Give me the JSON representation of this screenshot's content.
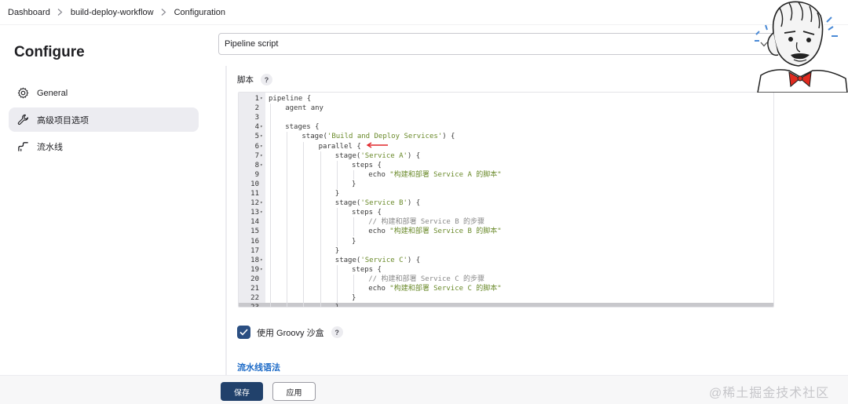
{
  "breadcrumb": {
    "items": [
      "Dashboard",
      "build-deploy-workflow",
      "Configuration"
    ]
  },
  "sidebar": {
    "title": "Configure",
    "items": [
      {
        "label": "General",
        "icon": "gear-icon"
      },
      {
        "label": "高级项目选项",
        "icon": "wrench-icon",
        "active": true
      },
      {
        "label": "流水线",
        "icon": "pipeline-icon"
      }
    ]
  },
  "definition": {
    "selected": "Pipeline script"
  },
  "script": {
    "label": "脚本",
    "help": "?",
    "lines": [
      {
        "n": "1",
        "fold": true,
        "indent": 0,
        "parts": [
          {
            "t": "pipeline {",
            "c": "kw"
          }
        ]
      },
      {
        "n": "2",
        "fold": false,
        "indent": 1,
        "parts": [
          {
            "t": "agent any",
            "c": "kw"
          }
        ]
      },
      {
        "n": "3",
        "fold": false,
        "indent": 0,
        "parts": []
      },
      {
        "n": "4",
        "fold": true,
        "indent": 1,
        "parts": [
          {
            "t": "stages {",
            "c": "kw"
          }
        ]
      },
      {
        "n": "5",
        "fold": true,
        "indent": 2,
        "parts": [
          {
            "t": "stage(",
            "c": "kw"
          },
          {
            "t": "'Build and Deploy Services'",
            "c": "str"
          },
          {
            "t": ") {",
            "c": "kw"
          }
        ]
      },
      {
        "n": "6",
        "fold": true,
        "indent": 3,
        "parts": [
          {
            "t": "parallel {",
            "c": "kw"
          }
        ]
      },
      {
        "n": "7",
        "fold": true,
        "indent": 4,
        "parts": [
          {
            "t": "stage(",
            "c": "kw"
          },
          {
            "t": "'Service A'",
            "c": "str"
          },
          {
            "t": ") {",
            "c": "kw"
          }
        ]
      },
      {
        "n": "8",
        "fold": true,
        "indent": 5,
        "parts": [
          {
            "t": "steps {",
            "c": "kw"
          }
        ]
      },
      {
        "n": "9",
        "fold": false,
        "indent": 6,
        "parts": [
          {
            "t": "echo ",
            "c": "kw"
          },
          {
            "t": "\"构建和部署 Service A 的脚本\"",
            "c": "str"
          }
        ]
      },
      {
        "n": "10",
        "fold": false,
        "indent": 5,
        "parts": [
          {
            "t": "}",
            "c": "kw"
          }
        ]
      },
      {
        "n": "11",
        "fold": false,
        "indent": 4,
        "parts": [
          {
            "t": "}",
            "c": "kw"
          }
        ]
      },
      {
        "n": "12",
        "fold": true,
        "indent": 4,
        "parts": [
          {
            "t": "stage(",
            "c": "kw"
          },
          {
            "t": "'Service B'",
            "c": "str"
          },
          {
            "t": ") {",
            "c": "kw"
          }
        ]
      },
      {
        "n": "13",
        "fold": true,
        "indent": 5,
        "parts": [
          {
            "t": "steps {",
            "c": "kw"
          }
        ]
      },
      {
        "n": "14",
        "fold": false,
        "indent": 6,
        "parts": [
          {
            "t": "// 构建和部署 Service B 的步骤",
            "c": "cmt"
          }
        ]
      },
      {
        "n": "15",
        "fold": false,
        "indent": 6,
        "parts": [
          {
            "t": "echo ",
            "c": "kw"
          },
          {
            "t": "\"构建和部署 Service B 的脚本\"",
            "c": "str"
          }
        ]
      },
      {
        "n": "16",
        "fold": false,
        "indent": 5,
        "parts": [
          {
            "t": "}",
            "c": "kw"
          }
        ]
      },
      {
        "n": "17",
        "fold": false,
        "indent": 4,
        "parts": [
          {
            "t": "}",
            "c": "kw"
          }
        ]
      },
      {
        "n": "18",
        "fold": true,
        "indent": 4,
        "parts": [
          {
            "t": "stage(",
            "c": "kw"
          },
          {
            "t": "'Service C'",
            "c": "str"
          },
          {
            "t": ") {",
            "c": "kw"
          }
        ]
      },
      {
        "n": "19",
        "fold": true,
        "indent": 5,
        "parts": [
          {
            "t": "steps {",
            "c": "kw"
          }
        ]
      },
      {
        "n": "20",
        "fold": false,
        "indent": 6,
        "parts": [
          {
            "t": "// 构建和部署 Service C 的步骤",
            "c": "cmt"
          }
        ]
      },
      {
        "n": "21",
        "fold": false,
        "indent": 6,
        "parts": [
          {
            "t": "echo ",
            "c": "kw"
          },
          {
            "t": "\"构建和部署 Service C 的脚本\"",
            "c": "str"
          }
        ]
      },
      {
        "n": "22",
        "fold": false,
        "indent": 5,
        "parts": [
          {
            "t": "}",
            "c": "kw"
          }
        ]
      },
      {
        "n": "23",
        "fold": false,
        "indent": 4,
        "parts": [
          {
            "t": "}",
            "c": "kw"
          }
        ]
      }
    ]
  },
  "groovy": {
    "label": "使用 Groovy 沙盒",
    "checked": true,
    "help": "?"
  },
  "links": {
    "pipeline_syntax": "流水线语法"
  },
  "buttons": {
    "save": "保存",
    "apply": "应用"
  },
  "watermark": "@稀土掘金技术社区",
  "colors": {
    "primary": "#21416b",
    "checkbox": "#2b4f82",
    "link": "#1c6ac7",
    "string": "#6a8a2a",
    "annotation_arrow": "#e0262a"
  }
}
